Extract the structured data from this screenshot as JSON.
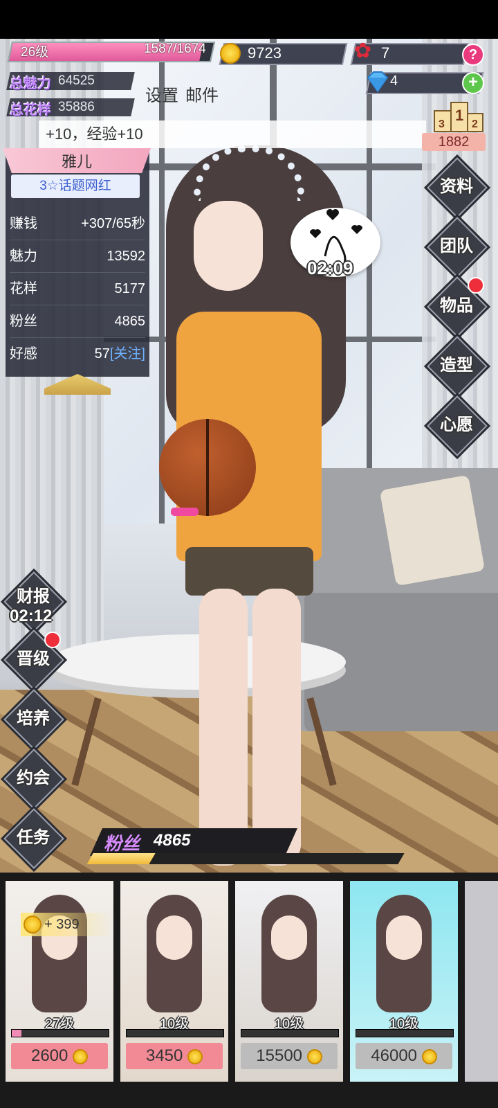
{
  "player": {
    "level": "26级",
    "exp": "1587/1674",
    "exp_fraction": 0.948,
    "coins": "9723",
    "roses": "7",
    "gems": "4"
  },
  "stats": {
    "charm_label": "总魅力",
    "charm_value": "64525",
    "style_label": "总花样",
    "style_value": "35886"
  },
  "top_links": {
    "settings": "设置",
    "mail": "邮件"
  },
  "marquee": "+10，经验+10",
  "rank": {
    "value": "1882"
  },
  "character": {
    "name": "雅儿",
    "tag": "3☆话题网红",
    "rows": [
      {
        "label": "赚钱",
        "value": "+307/65秒"
      },
      {
        "label": "魅力",
        "value": "13592"
      },
      {
        "label": "花样",
        "value": "5177"
      },
      {
        "label": "粉丝",
        "value": "4865"
      },
      {
        "label": "好感",
        "value": "57",
        "link": "[关注]"
      }
    ]
  },
  "right_menu": [
    "资料",
    "团队",
    "物品",
    "造型",
    "心愿"
  ],
  "left_menu": {
    "report_label": "财报",
    "report_timer": "02:12",
    "items": [
      "晋级",
      "培养",
      "约会",
      "任务"
    ]
  },
  "bubble_timer": "02:09",
  "fans": {
    "label": "粉丝",
    "value": "4865",
    "progress": 0.2
  },
  "cards": [
    {
      "level": "27级",
      "price": "2600",
      "bonus": "+ 399",
      "xp": 0.1,
      "price_color": "#f28a96"
    },
    {
      "level": "10级",
      "price": "3450",
      "xp": 0.0,
      "price_color": "#f28a96"
    },
    {
      "level": "10级",
      "price": "15500",
      "xp": 0.0,
      "price_color": "#bcbcbc"
    },
    {
      "level": "10级",
      "price": "46000",
      "xp": 0.0,
      "price_color": "#bcbcbc"
    }
  ],
  "colors": {
    "accent_pink": "#ea3a7e",
    "panel_bg": "#2a2c3a",
    "gold": "#f1b93a"
  },
  "icons": [
    "coin-icon",
    "rose-icon",
    "diamond-icon",
    "help-icon",
    "plus-icon",
    "podium-icon",
    "heart-bubble-icon"
  ]
}
